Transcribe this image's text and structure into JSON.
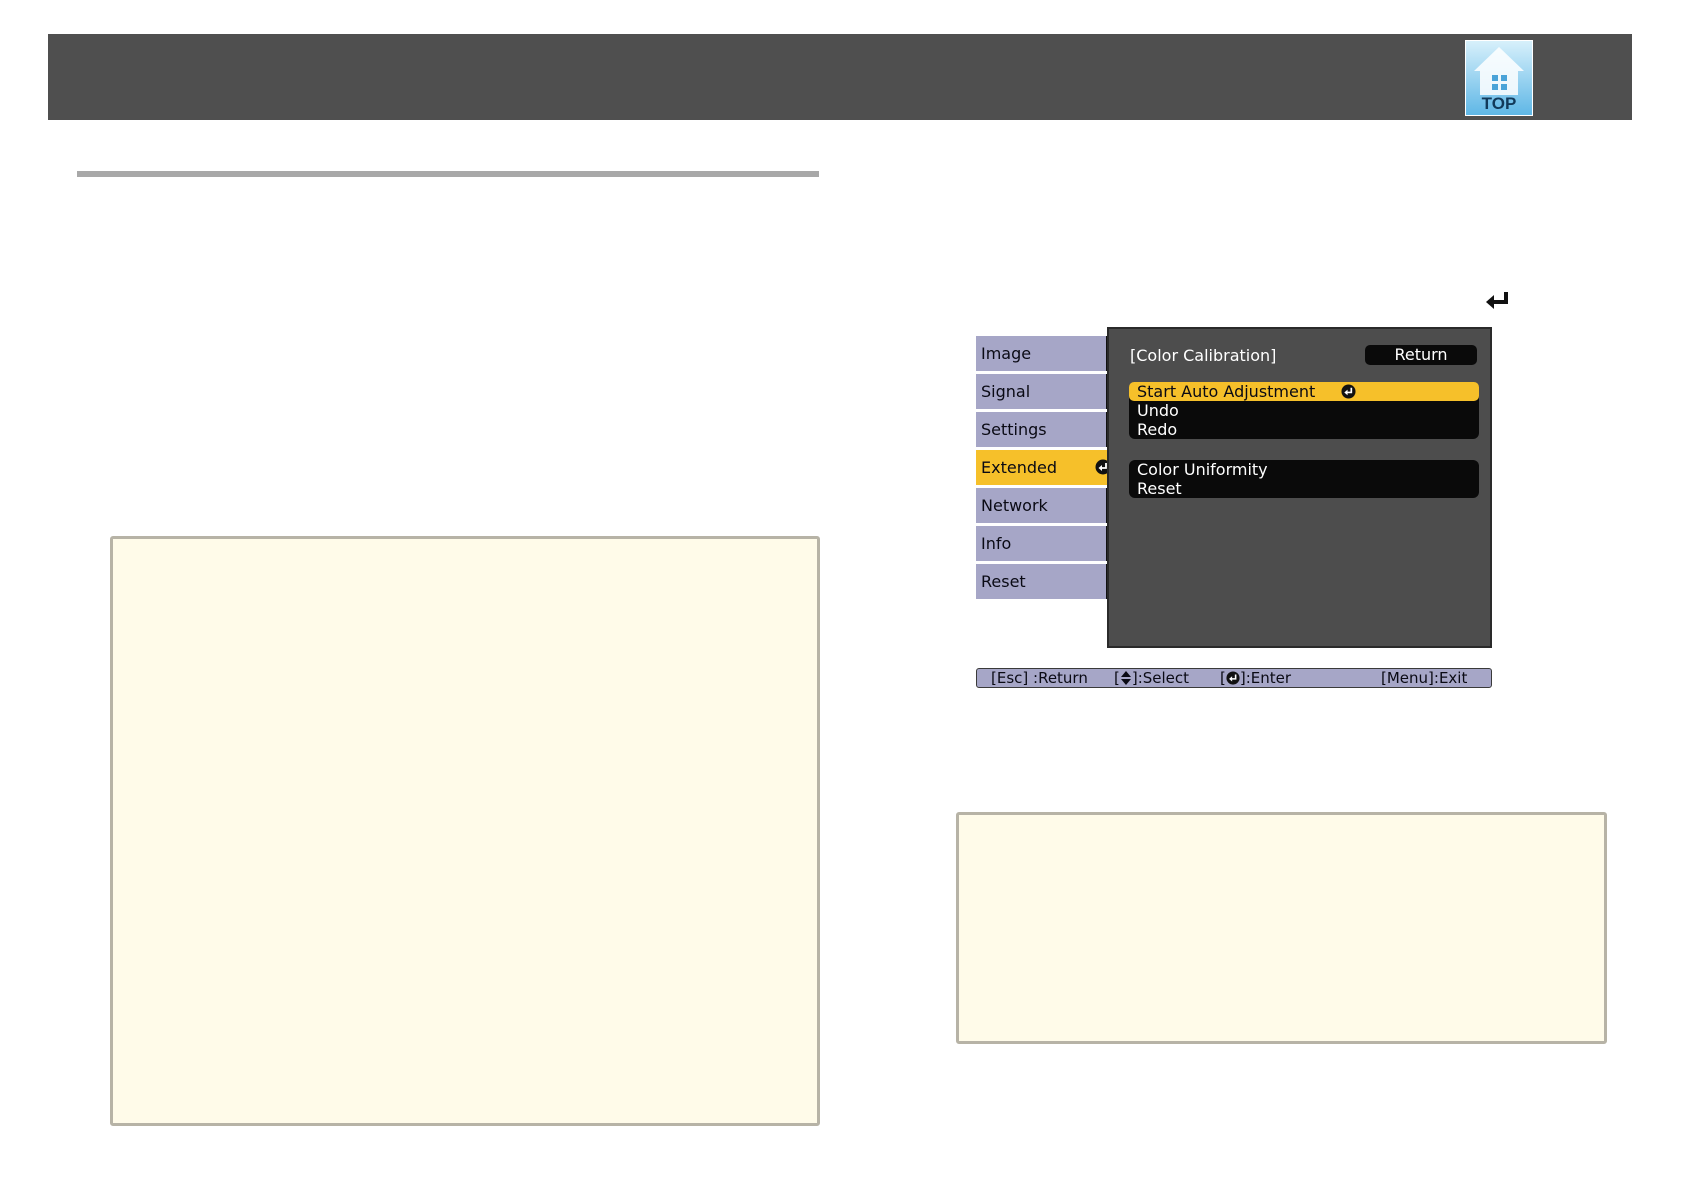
{
  "header": {
    "top_icon_label": "TOP"
  },
  "menu": {
    "tabs": [
      {
        "label": "Image"
      },
      {
        "label": "Signal"
      },
      {
        "label": "Settings"
      },
      {
        "label": "Extended"
      },
      {
        "label": "Network"
      },
      {
        "label": "Info"
      },
      {
        "label": "Reset"
      }
    ],
    "active_tab": "Extended",
    "panel_title": "[Color Calibration]",
    "return_label": "Return",
    "items": [
      {
        "label": "Start Auto Adjustment"
      },
      {
        "label": "Undo"
      },
      {
        "label": "Redo"
      },
      {
        "label": "Color Uniformity"
      },
      {
        "label": "Reset"
      }
    ],
    "selected_item": "Start Auto Adjustment"
  },
  "helpbar": {
    "esc": "[Esc] :Return",
    "select_prefix": "[",
    "select_suffix": "]:Select",
    "enter_prefix": "[",
    "enter_suffix": "]:Enter",
    "exit": "[Menu]:Exit"
  },
  "colors": {
    "banner": "#4f4f4f",
    "tab_bg": "#a6a6c7",
    "highlight": "#f6c02a",
    "panel_bg": "#4d4d4d",
    "note_bg": "#fffbe9",
    "note_border": "#b7b3a6"
  },
  "icons": {
    "top": "home-icon",
    "enter": "enter-icon"
  }
}
